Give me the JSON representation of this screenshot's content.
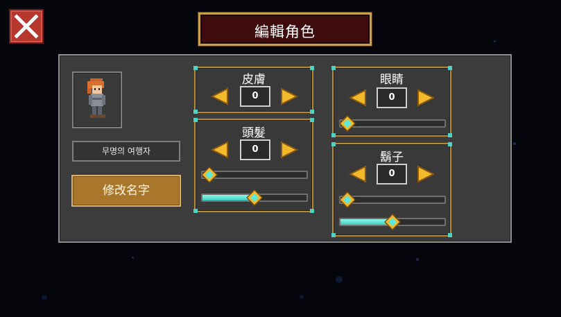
{
  "window": {
    "title": "編輯角色",
    "close_icon": "close-x-icon"
  },
  "character": {
    "name": "무명의 여행자",
    "rename_label": "修改名字"
  },
  "attributes": {
    "skin": {
      "label": "皮膚",
      "value": "0"
    },
    "hair": {
      "label": "頭髮",
      "value": "0",
      "slider1_fraction": 0.05,
      "slider2_fraction": 0.5
    },
    "eyes": {
      "label": "眼睛",
      "value": "0",
      "slider1_fraction": 0.05
    },
    "beard": {
      "label": "鬍子",
      "value": "0",
      "slider1_fraction": 0.05,
      "slider2_fraction": 0.5
    }
  },
  "colors": {
    "title_bg": "#3e0c0c",
    "gold_border": "#c9a04a",
    "button_gold": "#a9772c",
    "slider_fill": "#5ee8da",
    "close_red": "#b5372e"
  }
}
